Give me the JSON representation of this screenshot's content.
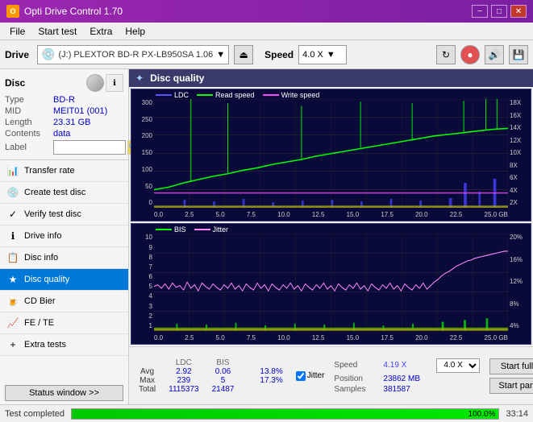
{
  "app": {
    "title": "Opti Drive Control 1.70",
    "icon": "O"
  },
  "title_controls": {
    "minimize": "−",
    "maximize": "□",
    "close": "✕"
  },
  "menu": {
    "items": [
      "File",
      "Start test",
      "Extra",
      "Help"
    ]
  },
  "toolbar": {
    "drive_label": "Drive",
    "drive_value": "(J:)  PLEXTOR BD-R  PX-LB950SA 1.06",
    "speed_label": "Speed",
    "speed_value": "4.0 X"
  },
  "disc": {
    "title": "Disc",
    "type_label": "Type",
    "type_value": "BD-R",
    "mid_label": "MID",
    "mid_value": "MEIT01 (001)",
    "length_label": "Length",
    "length_value": "23.31 GB",
    "contents_label": "Contents",
    "contents_value": "data",
    "label_label": "Label",
    "label_value": ""
  },
  "nav_items": [
    {
      "id": "transfer-rate",
      "label": "Transfer rate",
      "icon": "📊"
    },
    {
      "id": "create-test-disc",
      "label": "Create test disc",
      "icon": "💿"
    },
    {
      "id": "verify-test-disc",
      "label": "Verify test disc",
      "icon": "✓"
    },
    {
      "id": "drive-info",
      "label": "Drive info",
      "icon": "ℹ"
    },
    {
      "id": "disc-info",
      "label": "Disc info",
      "icon": "📋"
    },
    {
      "id": "disc-quality",
      "label": "Disc quality",
      "icon": "★",
      "active": true
    },
    {
      "id": "cd-bier",
      "label": "CD Bier",
      "icon": "🍺"
    },
    {
      "id": "fe-te",
      "label": "FE / TE",
      "icon": "📈"
    },
    {
      "id": "extra-tests",
      "label": "Extra tests",
      "icon": "+"
    }
  ],
  "status_button": "Status window >>",
  "chart": {
    "title": "Disc quality",
    "top_chart": {
      "legend": [
        {
          "label": "LDC",
          "color": "#4444ff"
        },
        {
          "label": "Read speed",
          "color": "#00ff00"
        },
        {
          "label": "Write speed",
          "color": "#ff00ff"
        }
      ],
      "y_labels_left": [
        "300",
        "250",
        "200",
        "150",
        "100",
        "50",
        "0"
      ],
      "y_labels_right": [
        "18X",
        "16X",
        "14X",
        "12X",
        "10X",
        "8X",
        "6X",
        "4X",
        "2X"
      ],
      "x_labels": [
        "0.0",
        "2.5",
        "5.0",
        "7.5",
        "10.0",
        "12.5",
        "15.0",
        "17.5",
        "20.0",
        "22.5",
        "25.0 GB"
      ]
    },
    "bottom_chart": {
      "legend": [
        {
          "label": "BIS",
          "color": "#00ff00"
        },
        {
          "label": "Jitter",
          "color": "#ff88ff"
        }
      ],
      "y_labels_left": [
        "10",
        "9",
        "8",
        "7",
        "6",
        "5",
        "4",
        "3",
        "2",
        "1"
      ],
      "y_labels_right": [
        "20%",
        "16%",
        "12%",
        "8%",
        "4%"
      ],
      "x_labels": [
        "0.0",
        "2.5",
        "5.0",
        "7.5",
        "10.0",
        "12.5",
        "15.0",
        "17.5",
        "20.0",
        "22.5",
        "25.0 GB"
      ]
    }
  },
  "stats": {
    "headers": [
      "LDC",
      "BIS",
      "",
      "Jitter",
      "Speed",
      ""
    ],
    "rows": [
      {
        "label": "Avg",
        "ldc": "2.92",
        "bis": "0.06",
        "jitter": "13.8%"
      },
      {
        "label": "Max",
        "ldc": "239",
        "bis": "5",
        "jitter": "17.3%"
      },
      {
        "label": "Total",
        "ldc": "1115373",
        "bis": "21487",
        "jitter": ""
      }
    ],
    "jitter_checked": true,
    "jitter_label": "Jitter",
    "speed_label": "Speed",
    "speed_value": "4.19 X",
    "speed_dropdown": "4.0 X",
    "position_label": "Position",
    "position_value": "23862 MB",
    "samples_label": "Samples",
    "samples_value": "381587",
    "start_full": "Start full",
    "start_part": "Start part"
  },
  "status_bar": {
    "text": "Test completed",
    "progress": 100.0,
    "progress_text": "100.0%",
    "time": "33:14"
  }
}
